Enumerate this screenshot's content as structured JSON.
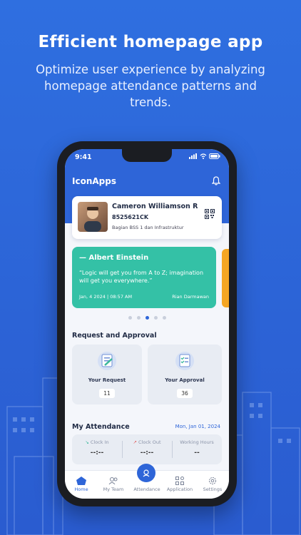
{
  "promo": {
    "headline": "Efficient homepage app",
    "subline": "Optimize user experience by analyzing homepage attendance patterns and trends."
  },
  "status": {
    "time": "9:41"
  },
  "app": {
    "title": "IconApps"
  },
  "profile": {
    "name": "Cameron Williamson R...",
    "id": "8525621CK",
    "department": "Bagian BSS 1 dan Infrastruktur"
  },
  "quote": {
    "author": "— Albert Einstein",
    "text": "“Logic will get you from A to Z; imagination will get you everywhere.”",
    "date": "Jan, 4 2024 | 08:57 AM",
    "by": "Rian Darmawan"
  },
  "carousel": {
    "count": 5,
    "active_index": 2
  },
  "requests": {
    "title": "Request and Approval",
    "items": [
      {
        "label": "Your Request",
        "count": "11"
      },
      {
        "label": "Your Approval",
        "count": "36"
      }
    ]
  },
  "attendance": {
    "title": "My Attendance",
    "date": "Mon, Jan 01, 2024",
    "columns": [
      {
        "label": "Clock In",
        "value": "--:--"
      },
      {
        "label": "Clock Out",
        "value": "--:--"
      },
      {
        "label": "Working Hours",
        "value": "--"
      }
    ]
  },
  "tabs": [
    {
      "label": "Home",
      "icon": "home-icon",
      "active": true
    },
    {
      "label": "My Team",
      "icon": "team-icon",
      "active": false
    },
    {
      "label": "Attendance",
      "icon": "attendance-icon",
      "active": false
    },
    {
      "label": "Application",
      "icon": "apps-icon",
      "active": false
    },
    {
      "label": "Settings",
      "icon": "gear-icon",
      "active": false
    }
  ],
  "colors": {
    "primary": "#2e65d8",
    "quote_bg": "#34c1a6",
    "accent_orange": "#f5a623"
  }
}
